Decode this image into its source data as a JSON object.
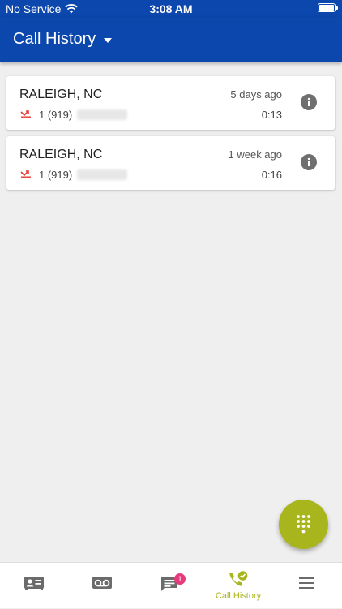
{
  "status_bar": {
    "carrier": "No Service",
    "time": "3:08 AM"
  },
  "header": {
    "title": "Call History"
  },
  "calls": [
    {
      "location": "RALEIGH, NC",
      "when": "5 days ago",
      "number": "1 (919)",
      "duration": "0:13"
    },
    {
      "location": "RALEIGH, NC",
      "when": "1 week ago",
      "number": "1 (919)",
      "duration": "0:16"
    }
  ],
  "nav": {
    "messages_badge": "1",
    "call_history_label": "Call History"
  },
  "colors": {
    "brand_blue": "#0b47ad",
    "accent_green": "#a9b51d",
    "missed_red": "#e53935",
    "badge_pink": "#e63a7e"
  },
  "icons": {
    "fab": "dialpad-icon",
    "nav": [
      "contacts-icon",
      "voicemail-icon",
      "messages-icon",
      "call-history-icon",
      "menu-icon"
    ]
  }
}
